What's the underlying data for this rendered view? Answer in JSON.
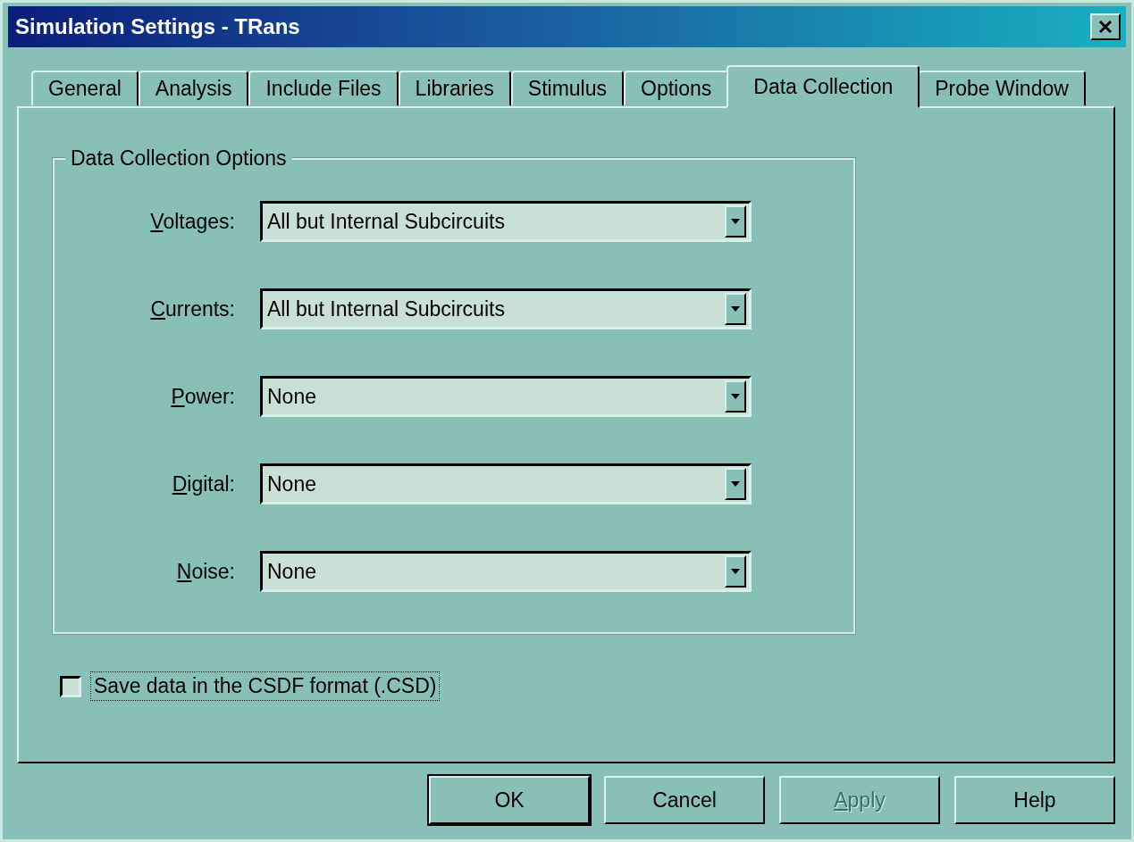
{
  "window": {
    "title": "Simulation Settings - TRans"
  },
  "tabs": [
    {
      "label": "General",
      "selected": false
    },
    {
      "label": "Analysis",
      "selected": false
    },
    {
      "label": "Include Files",
      "selected": false
    },
    {
      "label": "Libraries",
      "selected": false
    },
    {
      "label": "Stimulus",
      "selected": false
    },
    {
      "label": "Options",
      "selected": false
    },
    {
      "label": "Data Collection",
      "selected": true
    },
    {
      "label": "Probe Window",
      "selected": false
    }
  ],
  "group": {
    "title": "Data Collection Options",
    "fields": [
      {
        "label": "Voltages:",
        "value": "All but Internal Subcircuits"
      },
      {
        "label": "Currents:",
        "value": "All but Internal Subcircuits"
      },
      {
        "label": "Power:",
        "value": "None"
      },
      {
        "label": "Digital:",
        "value": "None"
      },
      {
        "label": "Noise:",
        "value": "None"
      }
    ]
  },
  "checkbox": {
    "label": "Save data in the CSDF format (.CSD)",
    "checked": false
  },
  "buttons": [
    {
      "label": "OK",
      "default": true,
      "disabled": false,
      "mnemonic": false
    },
    {
      "label": "Cancel",
      "default": false,
      "disabled": false,
      "mnemonic": false
    },
    {
      "label": "Apply",
      "default": false,
      "disabled": true,
      "mnemonic": true
    },
    {
      "label": "Help",
      "default": false,
      "disabled": false,
      "mnemonic": false
    }
  ]
}
